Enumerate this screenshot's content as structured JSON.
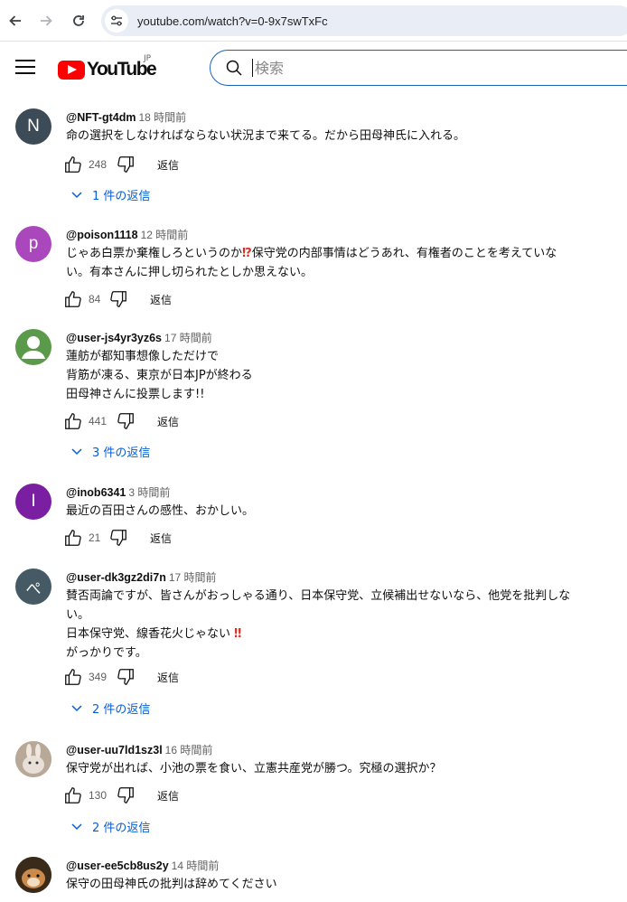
{
  "browser": {
    "url": "youtube.com/watch?v=0-9x7swTxFc"
  },
  "header": {
    "logo_text": "YouTube",
    "logo_region": "JP",
    "search_placeholder": "検索"
  },
  "comments": [
    {
      "author": "@NFT-gt4dm",
      "time": "18 時間前",
      "avatar_letter": "N",
      "avatar_color": "#3d4b57",
      "text": "命の選択をしなければならない状況まで来てる。だから田母神氏に入れる。",
      "likes": "248",
      "reply_label": "返信",
      "replies_label": "1 件の返信"
    },
    {
      "author": "@poison1118",
      "time": "12 時間前",
      "avatar_letter": "p",
      "avatar_color": "#ab47bc",
      "text_parts": [
        "じゃあ白票か棄権しろというのか",
        "⁉",
        "保守党の内部事情はどうあれ、有権者のことを考えていな\nい。有本さんに押し切られたとしか思えない。"
      ],
      "likes": "84",
      "reply_label": "返信"
    },
    {
      "author": "@user-js4yr3yz6s",
      "time": "17 時間前",
      "avatar_color": "#5b9a4a",
      "text": "蓮舫が都知事想像しただけで\n背筋が凍る、東京が日本JPが終わる\n田母神さんに投票します!!",
      "likes": "441",
      "reply_label": "返信",
      "replies_label": "3 件の返信"
    },
    {
      "author": "@inob6341",
      "time": "3 時間前",
      "avatar_letter": "I",
      "avatar_color": "#7b1fa2",
      "text": "最近の百田さんの感性、おかしい。",
      "likes": "21",
      "reply_label": "返信"
    },
    {
      "author": "@user-dk3gz2di7n",
      "time": "17 時間前",
      "avatar_letter": "ぺ",
      "avatar_color": "#455a64",
      "text_parts": [
        "賛否両論ですが、皆さんがおっしゃる通り、日本保守党、立候補出せないなら、他党を批判しな\nい。\n日本保守党、線香花火じゃない ",
        "‼",
        "\nがっかりです。"
      ],
      "likes": "349",
      "reply_label": "返信",
      "replies_label": "2 件の返信"
    },
    {
      "author": "@user-uu7ld1sz3l",
      "time": "16 時間前",
      "avatar_color": "#c9b8a8",
      "text": "保守党が出れば、小池の票を食い、立憲共産党が勝つ。究極の選択か？",
      "likes": "130",
      "reply_label": "返信",
      "replies_label": "2 件の返信"
    },
    {
      "author": "@user-ee5cb8us2y",
      "time": "14 時間前",
      "avatar_color": "#8a5a2b",
      "text": "保守の田母神氏の批判は辞めてください"
    }
  ]
}
